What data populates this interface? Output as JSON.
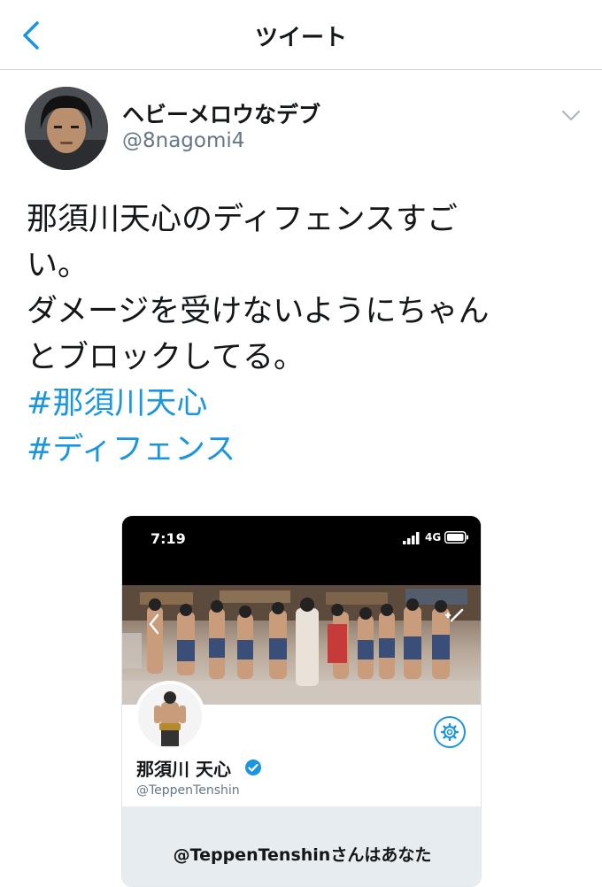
{
  "nav": {
    "title": "ツイート",
    "back_icon": "chevron-left-icon"
  },
  "tweet": {
    "display_name": "ヘビーメロウなデブ",
    "handle": "@8nagomi4",
    "body_lines": [
      "那須川天心のディフェンスすご",
      "い。",
      "ダメージを受けないようにちゃん",
      "とブロックしてる。"
    ],
    "hashtags": [
      "#那須川天心",
      "#ディフェンス"
    ],
    "caret_icon": "chevron-down-icon"
  },
  "embedded_screenshot": {
    "status_time": "7:19",
    "network": "4G",
    "profile_name": "那須川 天心",
    "profile_handle": "@TeppenTenshin",
    "notice_text": "@TeppenTenshinさんはあなた"
  },
  "colors": {
    "accent": "#1b95e0",
    "text": "#14171a",
    "muted": "#657786"
  }
}
